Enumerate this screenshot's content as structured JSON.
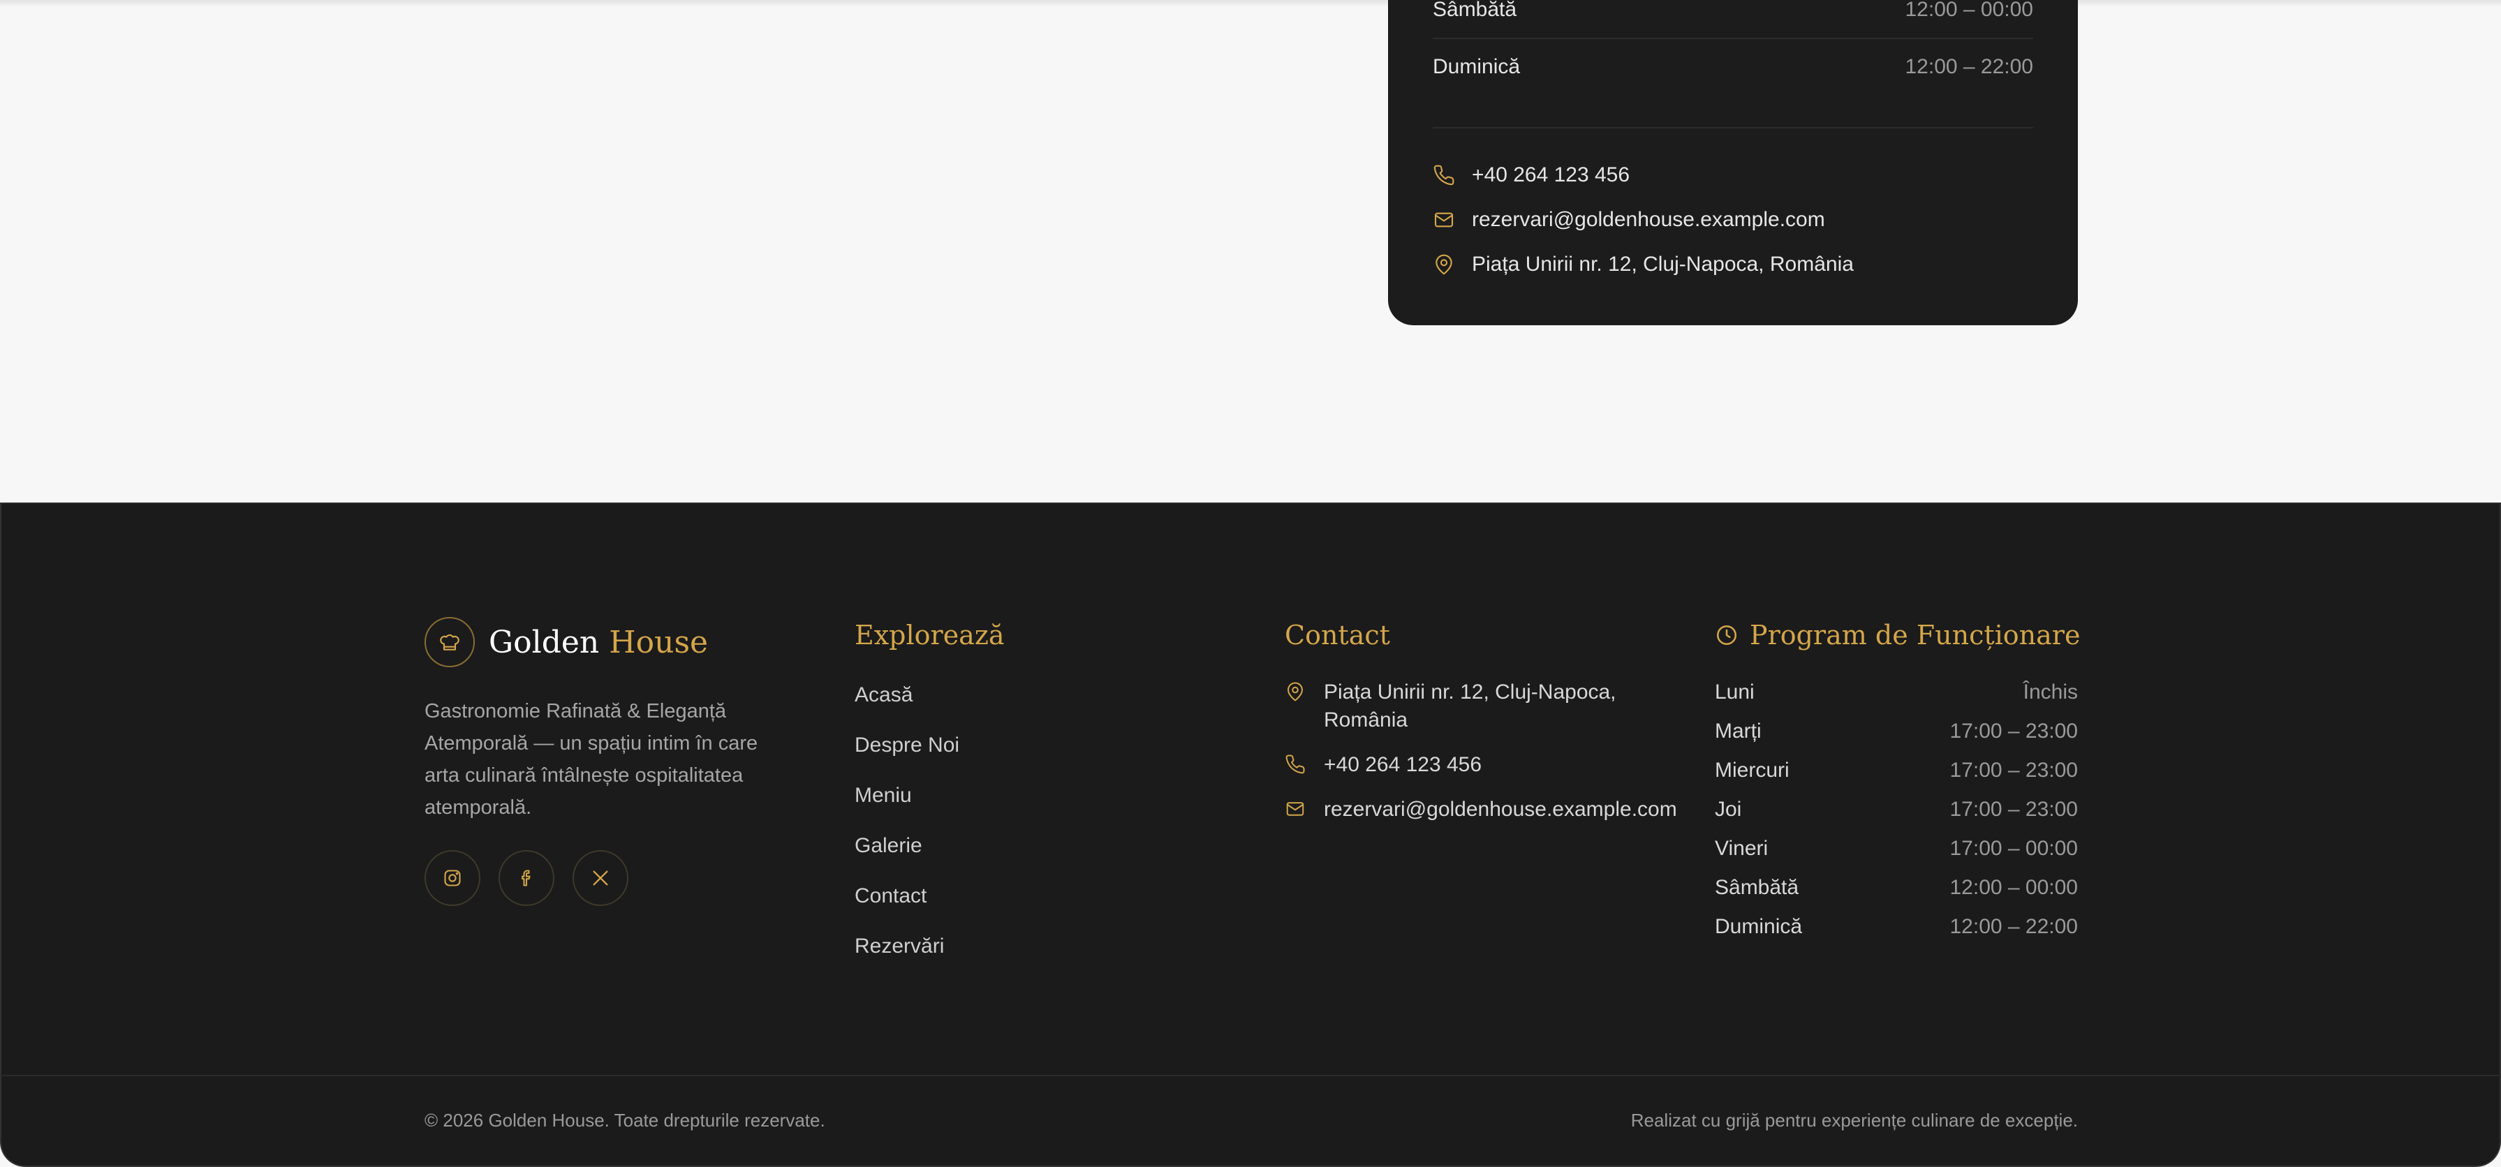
{
  "card": {
    "hours": [
      {
        "day": "Sâmbătă",
        "time": "12:00 – 00:00"
      },
      {
        "day": "Duminică",
        "time": "12:00 – 22:00"
      }
    ],
    "phone": "+40 264 123 456",
    "email": "rezervari@goldenhouse.example.com",
    "address": "Piața Unirii nr. 12, Cluj-Napoca, România"
  },
  "footer": {
    "brand": {
      "first": "Golden",
      "second": "House"
    },
    "description": "Gastronomie Rafinată & Eleganță Atemporală — un spațiu intim în care arta culinară întâlnește ospitalitatea atemporală.",
    "explore_title": "Explorează",
    "nav": [
      "Acasă",
      "Despre Noi",
      "Meniu",
      "Galerie",
      "Contact",
      "Rezervări"
    ],
    "contact_title": "Contact",
    "contact": {
      "address": "Piața Unirii nr. 12, Cluj-Napoca, România",
      "phone": "+40 264 123 456",
      "email": "rezervari@goldenhouse.example.com"
    },
    "hours_title": "Program de Funcționare",
    "hours": [
      {
        "day": "Luni",
        "time": "Închis"
      },
      {
        "day": "Marți",
        "time": "17:00 – 23:00"
      },
      {
        "day": "Miercuri",
        "time": "17:00 – 23:00"
      },
      {
        "day": "Joi",
        "time": "17:00 – 23:00"
      },
      {
        "day": "Vineri",
        "time": "17:00 – 00:00"
      },
      {
        "day": "Sâmbătă",
        "time": "12:00 – 00:00"
      },
      {
        "day": "Duminică",
        "time": "12:00 – 22:00"
      }
    ],
    "copyright": "© 2026 Golden House. Toate drepturile rezervate.",
    "credit": "Realizat cu grijă pentru experiențe culinare de excepție."
  },
  "icons": {
    "phone": "phone-icon",
    "email": "mail-icon",
    "location": "map-pin-icon",
    "clock": "clock-icon",
    "logo": "chef-hat-icon",
    "instagram": "instagram-icon",
    "facebook": "facebook-icon",
    "x": "x-icon"
  },
  "colors": {
    "accent": "#d4a64a",
    "footer_bg": "#1b1b1b",
    "page_bg": "#f7f7f7"
  }
}
